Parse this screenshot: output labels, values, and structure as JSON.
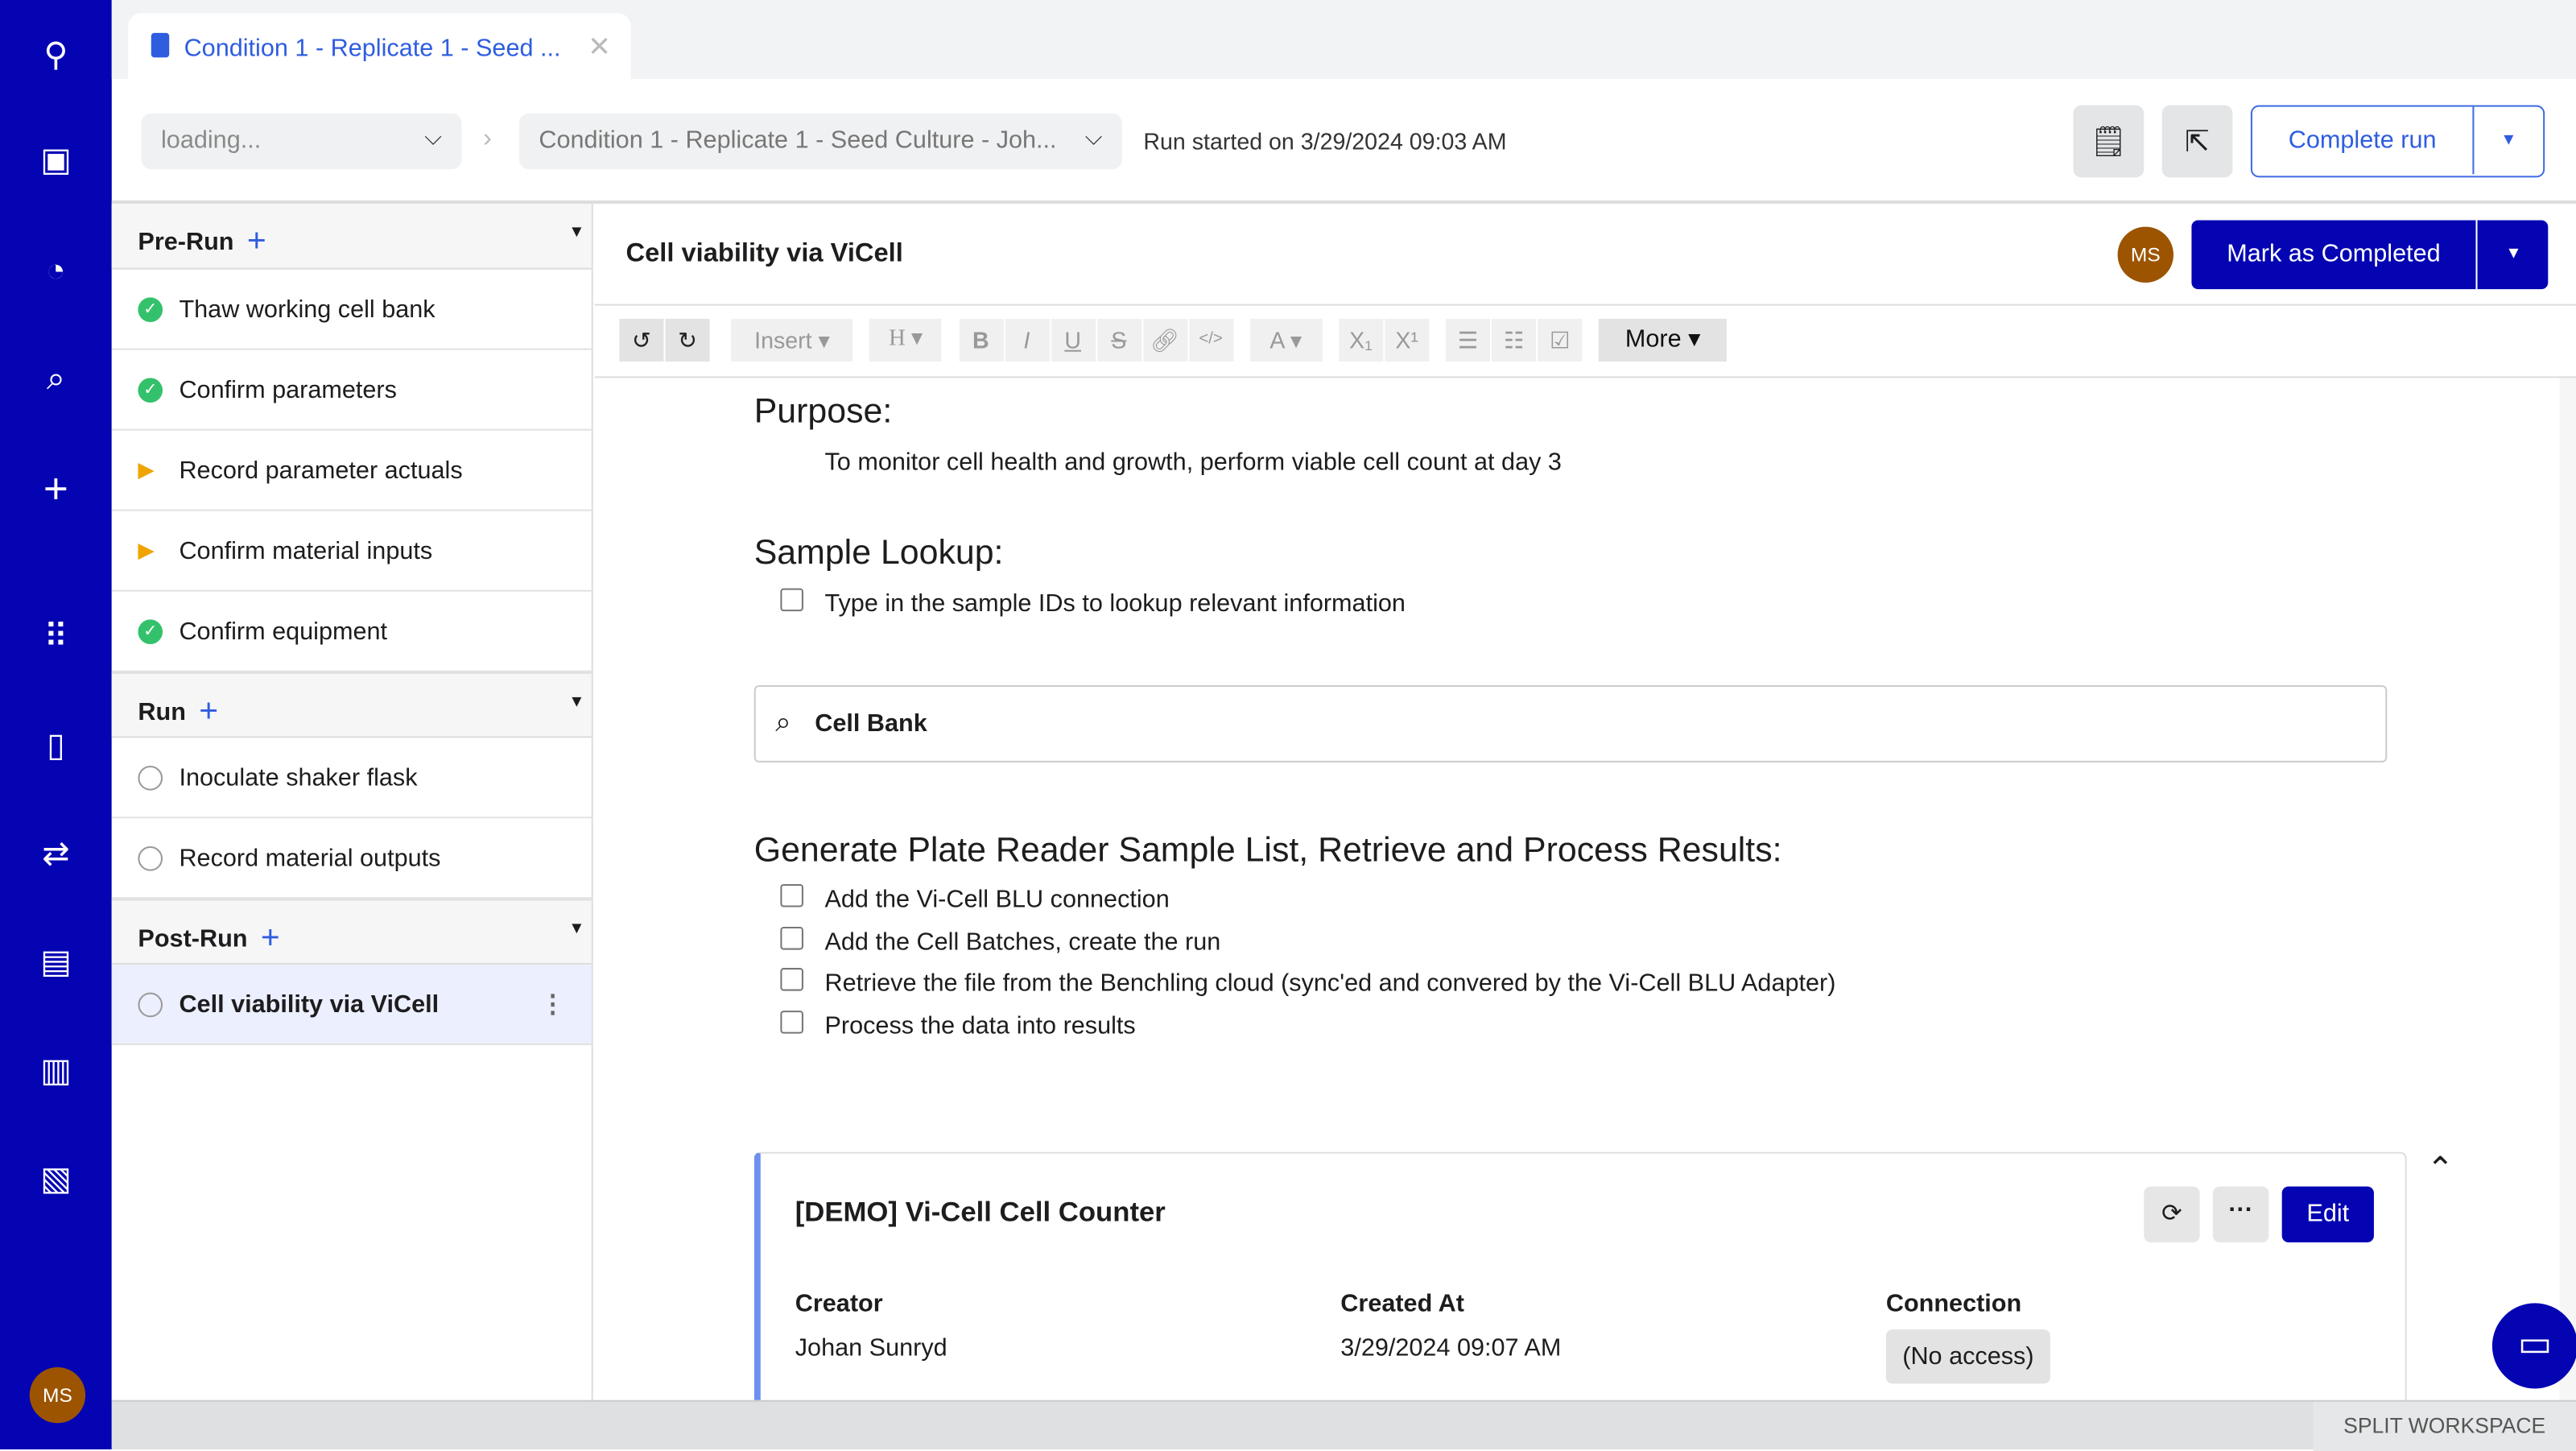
{
  "nav": {
    "items": [
      "logo",
      "briefcase",
      "dashboard",
      "search",
      "add",
      "apps",
      "notebook",
      "workflows",
      "tasks",
      "analytics",
      "inventory"
    ],
    "user_initials": "MS"
  },
  "tab": {
    "title": "Condition 1 - Replicate 1 - Seed ...",
    "close": "✕"
  },
  "header": {
    "project_select": "loading...",
    "entry_select": "Condition 1 - Replicate 1 - Seed Culture - Joh...",
    "run_started": "Run started on 3/29/2024 09:03 AM",
    "complete_run": "Complete run"
  },
  "sidebar": {
    "sections": [
      {
        "label": "Pre-Run",
        "items": [
          {
            "label": "Thaw working cell bank",
            "status": "done"
          },
          {
            "label": "Confirm parameters",
            "status": "done"
          },
          {
            "label": "Record parameter actuals",
            "status": "partial"
          },
          {
            "label": "Confirm material inputs",
            "status": "partial"
          },
          {
            "label": "Confirm equipment",
            "status": "done"
          }
        ]
      },
      {
        "label": "Run",
        "items": [
          {
            "label": "Inoculate shaker flask",
            "status": "open"
          },
          {
            "label": "Record material outputs",
            "status": "open"
          }
        ]
      },
      {
        "label": "Post-Run",
        "items": [
          {
            "label": "Cell viability via ViCell",
            "status": "open",
            "active": true
          }
        ]
      }
    ]
  },
  "doc": {
    "title": "Cell viability via ViCell",
    "assignee": "MS",
    "mark_completed": "Mark as Completed",
    "toolbar": {
      "insert": "Insert",
      "heading": "H",
      "font_color": "A",
      "more": "More"
    },
    "purpose_heading": "Purpose:",
    "purpose_text": "To monitor cell health and growth, perform viable cell count at day 3",
    "lookup_heading": "Sample Lookup:",
    "lookup_task": "Type in the sample IDs to lookup relevant information",
    "search_value": "Cell Bank",
    "generate_heading": "Generate Plate Reader Sample List, Retrieve and Process Results:",
    "tasks": [
      "Add the Vi-Cell BLU connection",
      "Add the Cell Batches, create the run",
      "Retrieve the file from the Benchling cloud (sync'ed and convered by the Vi-Cell BLU Adapter)",
      "Process the data into results"
    ],
    "card": {
      "title": "[DEMO] Vi-Cell Cell Counter",
      "edit": "Edit",
      "creator_label": "Creator",
      "creator": "Johan Sunryd",
      "created_label": "Created At",
      "created": "3/29/2024 09:07 AM",
      "connection_label": "Connection",
      "connection": "(No access)"
    }
  },
  "footer": {
    "split": "SPLIT WORKSPACE"
  },
  "colors": {
    "nav": "#0404b3",
    "accent": "#2f5de0",
    "primary": "#0404b3"
  }
}
